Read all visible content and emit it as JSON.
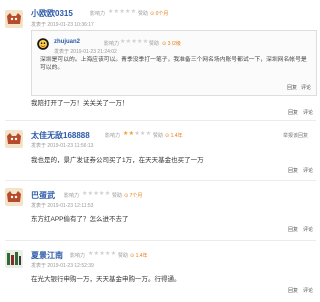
{
  "meta_labels": {
    "influence": "影响力",
    "posted_at": "发表于",
    "reply": "回复",
    "comment": "评论",
    "praise": "赞"
  },
  "quote": {
    "author": "zhujuan2",
    "influence_label": "影响力",
    "praise": "赞助",
    "level_num": "3",
    "level_label": "3 /2级",
    "time": "2019-01-23 21:24:02",
    "text": "深圳是可以的。上海应该可以。青季没季打一笔子，我准备三个网名场内账号都试一下，深圳网名帐号是可以的。"
  },
  "posts": [
    {
      "id": "p1",
      "username": "小欧欧0315",
      "influence_label": "影响力",
      "stars_filled": 0,
      "praise": "赞助",
      "level": "0个月",
      "posted_prefix": "发表于",
      "time": "2019-01-23 10:36:17",
      "content": "我陪打开了一万！关关关了一万！",
      "actions": [
        "回复",
        "评论"
      ],
      "avatar_color": "#b64a2a"
    },
    {
      "id": "p2",
      "username": "太佳无敌168888",
      "influence_label": "影响力",
      "stars_filled": 2,
      "praise": "赞助",
      "level": "1.4年",
      "posted_prefix": "发表于",
      "time": "2019-01-23 11:56:13",
      "content": "我也是的，景广发证券公司买了1万，在天天基金也买了一万",
      "top_right": "举报该回复",
      "actions": [
        "回复",
        "评论"
      ],
      "avatar_color": "#b64a2a"
    },
    {
      "id": "p3",
      "username": "巴蛋武",
      "influence_label": "影响力",
      "stars_filled": 0,
      "praise": "赞助",
      "level": "7个月",
      "posted_prefix": "发表于",
      "time": "2019-01-23 12:11:53",
      "content": "东方红APP偷有了？怎么进不去了",
      "actions": [
        "回复",
        "评论"
      ],
      "avatar_color": "#b64a2a"
    },
    {
      "id": "p4",
      "username": "夏景江南",
      "influence_label": "影响力",
      "stars_filled": 0,
      "praise": "赞助",
      "level": "1.4年",
      "posted_prefix": "发表于",
      "time": "2019-01-23 12:52:39",
      "content": "在光大银行申购一万，天天基金申购一万。行得通。",
      "actions": [
        "回复",
        "评论"
      ],
      "avatar_color": "#2f6b3a"
    }
  ]
}
